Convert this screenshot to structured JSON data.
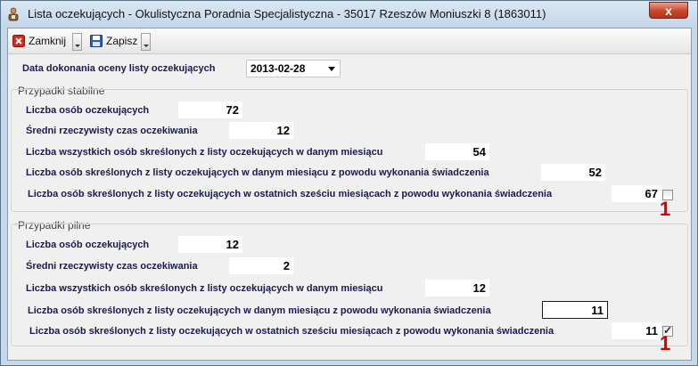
{
  "window": {
    "title": "Lista oczekujących - Okulistyczna Poradnia Specjalistyczna - 35017 Rzeszów Moniuszki 8 (1863011)",
    "close_label": "x"
  },
  "toolbar": {
    "close_label": "Zamknij",
    "save_label": "Zapisz"
  },
  "form": {
    "date_label": "Data dokonania oceny listy oczekujących",
    "date_value": "2013-02-28"
  },
  "stable": {
    "group_title": "Przypadki stabilne",
    "rows": [
      {
        "label": "Liczba osób oczekujących",
        "value": "72"
      },
      {
        "label": "Średni rzeczywisty czas oczekiwania",
        "value": "12"
      },
      {
        "label": "Liczba wszystkich osób skreślonych z listy oczekujących w danym miesiącu",
        "value": "54"
      },
      {
        "label": "Liczba osób skreślonych z listy oczekujących w danym miesiącu z powodu wykonania świadczenia",
        "value": "52"
      },
      {
        "label": "Liczba osób skreślonych z listy oczekujących w ostatnich sześciu miesiącach z powodu wykonania świadczenia",
        "value": "67",
        "checked": false,
        "annotation": "1"
      }
    ]
  },
  "urgent": {
    "group_title": "Przypadki pilne",
    "rows": [
      {
        "label": "Liczba osób oczekujących",
        "value": "12"
      },
      {
        "label": "Średni rzeczywisty czas oczekiwania",
        "value": "2"
      },
      {
        "label": "Liczba wszystkich osób skreślonych z listy oczekujących w danym miesiącu",
        "value": "12"
      },
      {
        "label": "Liczba osób skreślonych z listy oczekujących w danym miesiącu z powodu wykonania świadczenia",
        "value": "11"
      },
      {
        "label": "Liczba osób skreślonych z listy oczekujących w ostatnich sześciu miesiącach z powodu wykonania świadczenia",
        "value": "11",
        "checked": true,
        "annotation": "1"
      }
    ]
  }
}
